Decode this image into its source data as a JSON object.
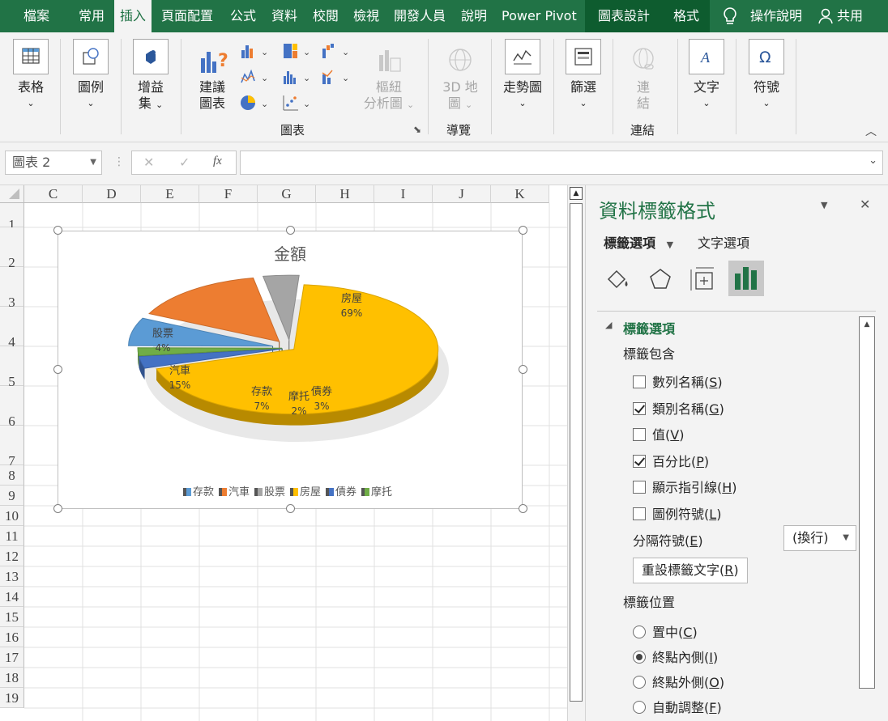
{
  "ribbon": {
    "tabs": [
      "檔案",
      "常用",
      "插入",
      "頁面配置",
      "公式",
      "資料",
      "校閱",
      "檢視",
      "開發人員",
      "說明",
      "Power Pivot",
      "圖表設計",
      "格式"
    ],
    "tell_me": "操作說明",
    "share": "共用",
    "buttons": {
      "table": "表格",
      "illustrations": "圖例",
      "addins_1": "增益",
      "addins_2": "集",
      "recommended_1": "建議",
      "recommended_2": "圖表",
      "pivot_1": "樞紐",
      "pivot_2": "分析圖",
      "map3d_1": "3D 地",
      "map3d_2": "圖",
      "sparklines": "走勢圖",
      "filters": "篩選",
      "link_1": "連",
      "link_2": "結",
      "text": "文字",
      "symbols": "符號"
    },
    "groups": {
      "charts": "圖表",
      "tours": "導覽",
      "links": "連結"
    }
  },
  "formula_bar": {
    "name_box": "圖表 2",
    "fx": "fx"
  },
  "sheet": {
    "columns": [
      "C",
      "D",
      "E",
      "F",
      "G",
      "H",
      "I",
      "J",
      "K"
    ],
    "rows": [
      "1",
      "2",
      "3",
      "4",
      "5",
      "6",
      "7",
      "8",
      "9",
      "10",
      "11",
      "12",
      "13",
      "14",
      "15",
      "16",
      "17",
      "18",
      "19"
    ]
  },
  "chart_data": {
    "type": "pie",
    "title": "金額",
    "categories": [
      "存款",
      "汽車",
      "股票",
      "房屋",
      "債券",
      "摩托"
    ],
    "values": [
      7,
      15,
      4,
      69,
      3,
      2
    ],
    "value_unit": "%",
    "data_labels": [
      {
        "name": "房屋",
        "pct": "69%"
      },
      {
        "name": "股票",
        "pct": "4%"
      },
      {
        "name": "汽車",
        "pct": "15%"
      },
      {
        "name": "存款",
        "pct": "7%"
      },
      {
        "name": "摩托",
        "pct": "2%"
      },
      {
        "name": "債券",
        "pct": "3%"
      }
    ],
    "legend": [
      "存款",
      "汽車",
      "股票",
      "房屋",
      "債券",
      "摩托"
    ],
    "legend_position": "bottom",
    "colors": {
      "存款": "#5b9bd5",
      "汽車": "#ed7d31",
      "股票": "#a5a5a5",
      "房屋": "#ffc000",
      "債券": "#4472c4",
      "摩托": "#70ad47"
    }
  },
  "pane": {
    "title": "資料標籤格式",
    "tabs": {
      "label_options": "標籤選項",
      "text_options": "文字選項"
    },
    "section": "標籤選項",
    "contains": "標籤包含",
    "checkboxes": [
      {
        "label": "數列名稱",
        "key": "S",
        "checked": false
      },
      {
        "label": "類別名稱",
        "key": "G",
        "checked": true
      },
      {
        "label": "值",
        "key": "V",
        "checked": false
      },
      {
        "label": "百分比",
        "key": "P",
        "checked": true
      },
      {
        "label": "顯示指引線",
        "key": "H",
        "checked": false
      },
      {
        "label": "圖例符號",
        "key": "L",
        "checked": false
      }
    ],
    "separator_label": "分隔符號",
    "separator_key": "E",
    "separator_value": "(換行)",
    "reset_button": "重設標籤文字",
    "reset_key": "R",
    "position_label": "標籤位置",
    "positions": [
      {
        "label": "置中",
        "key": "C",
        "selected": false
      },
      {
        "label": "終點內側",
        "key": "I",
        "selected": true
      },
      {
        "label": "終點外側",
        "key": "O",
        "selected": false
      },
      {
        "label": "自動調整",
        "key": "F",
        "selected": false
      }
    ]
  }
}
